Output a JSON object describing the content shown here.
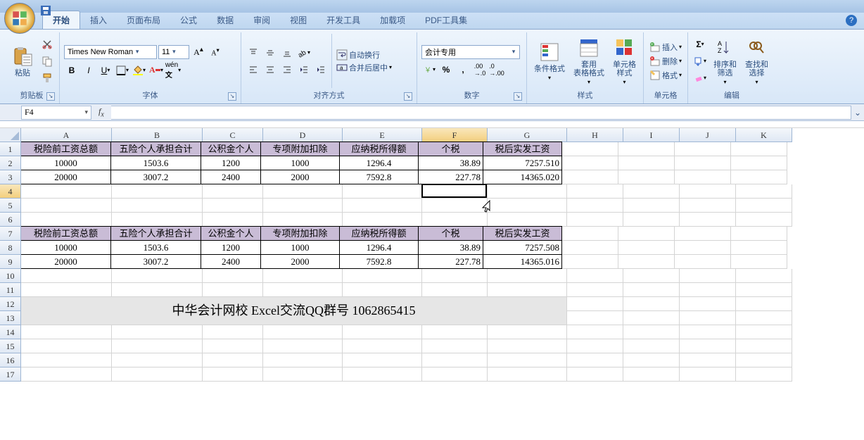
{
  "tabs": {
    "active": "开始",
    "items": [
      "开始",
      "插入",
      "页面布局",
      "公式",
      "数据",
      "审阅",
      "视图",
      "开发工具",
      "加载项",
      "PDF工具集"
    ]
  },
  "ribbon": {
    "clipboard": {
      "paste": "粘贴",
      "label": "剪贴板"
    },
    "font": {
      "family": "Times New Roman",
      "size": "11",
      "label": "字体"
    },
    "align": {
      "wrap": "自动换行",
      "merge": "合并后居中",
      "label": "对齐方式"
    },
    "number": {
      "format": "会计专用",
      "label": "数字"
    },
    "styles": {
      "cond": "条件格式",
      "table": "套用\n表格格式",
      "cell": "单元格\n样式",
      "label": "样式"
    },
    "cells": {
      "insert": "插入",
      "delete": "删除",
      "format": "格式",
      "label": "单元格"
    },
    "editing": {
      "sort": "排序和\n筛选",
      "find": "查找和\n选择",
      "label": "编辑"
    }
  },
  "name_box": "F4",
  "formula": "",
  "columns": [
    "A",
    "B",
    "C",
    "D",
    "E",
    "F",
    "G",
    "H",
    "I",
    "J",
    "K"
  ],
  "rows": [
    "1",
    "2",
    "3",
    "4",
    "5",
    "6",
    "7",
    "8",
    "9",
    "10",
    "11",
    "12",
    "13",
    "14",
    "15",
    "16",
    "17"
  ],
  "active_cell": {
    "col": 5,
    "row": 3
  },
  "table1": {
    "headers": [
      "税险前工资总额",
      "五险个人承担合计",
      "公积金个人",
      "专项附加扣除",
      "应纳税所得额",
      "个税",
      "税后实发工资"
    ],
    "rows": [
      [
        "10000",
        "1503.6",
        "1200",
        "1000",
        "1296.4",
        "38.89",
        "7257.510"
      ],
      [
        "20000",
        "3007.2",
        "2400",
        "2000",
        "7592.8",
        "227.78",
        "14365.020"
      ]
    ]
  },
  "table2": {
    "headers": [
      "税险前工资总额",
      "五险个人承担合计",
      "公积金个人",
      "专项附加扣除",
      "应纳税所得额",
      "个税",
      "税后实发工资"
    ],
    "rows": [
      [
        "10000",
        "1503.6",
        "1200",
        "1000",
        "1296.4",
        "38.89",
        "7257.508"
      ],
      [
        "20000",
        "3007.2",
        "2400",
        "2000",
        "7592.8",
        "227.78",
        "14365.016"
      ]
    ]
  },
  "banner": "中华会计网校 Excel交流QQ群号 1062865415",
  "help": "?"
}
